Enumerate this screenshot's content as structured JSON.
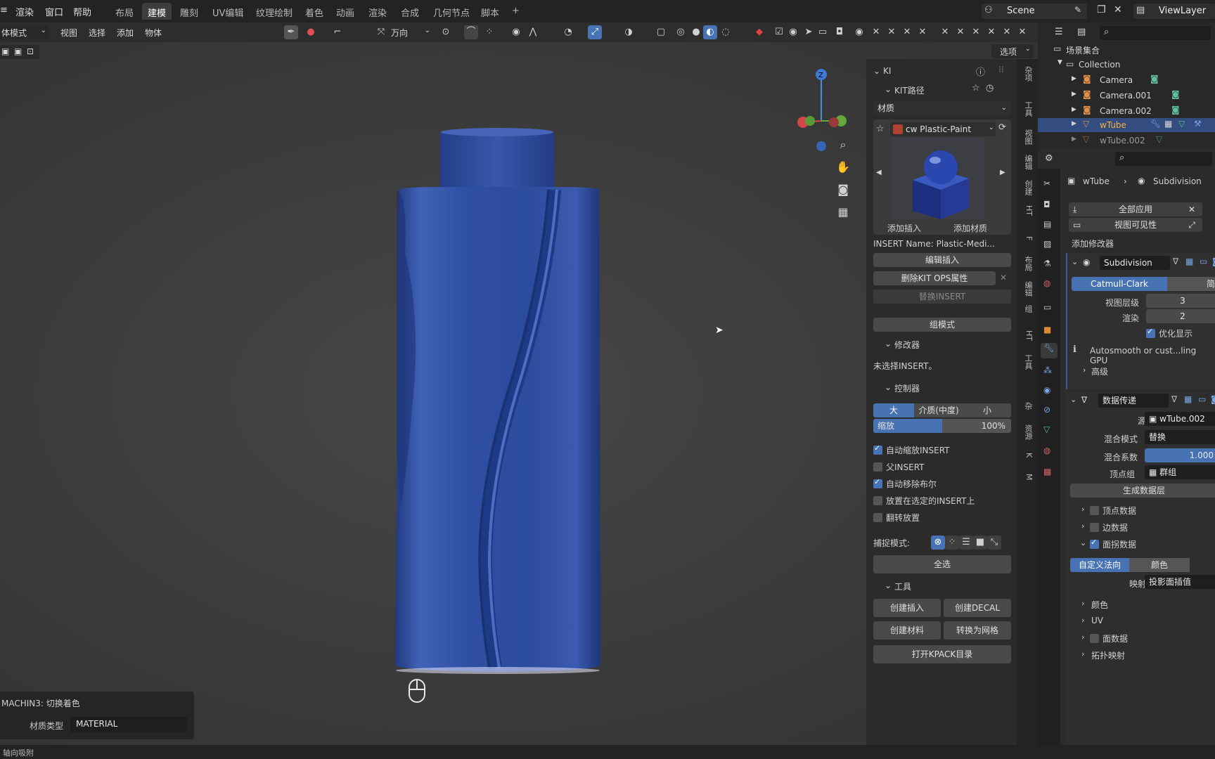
{
  "topbar": {
    "menus": [
      "渲染",
      "窗口",
      "帮助"
    ],
    "workspaces": [
      "布局",
      "建模",
      "雕刻",
      "UV编辑",
      "纹理绘制",
      "着色",
      "动画",
      "渲染",
      "合成",
      "几何节点",
      "脚本"
    ],
    "active_workspace": "建模",
    "add_tab": "+",
    "scene": "Scene",
    "viewlayer": "ViewLayer"
  },
  "header": {
    "mode": "体模式",
    "menus": [
      "视图",
      "选择",
      "添加",
      "物体"
    ],
    "orientation": "万向",
    "options": "选项"
  },
  "viewport": {
    "gizmo_axis": "Z",
    "object_color": "#2f4fa3"
  },
  "machin3_panel": {
    "title": "MACHIN3: 切换着色",
    "field_label": "材质类型",
    "field_value": "MATERIAL"
  },
  "npanel": {
    "section_kit": "KI",
    "section_kit_path": "KIT路径",
    "dropdown": "材质",
    "material_name": "cw Plastic-Paint",
    "btn_add_insert": "添加插入",
    "btn_add_material": "添加材质",
    "insert_name": "INSERT Name: Plastic-Medi...",
    "btn_edit_insert": "编辑插入",
    "btn_delete_kitops": "删除KIT OPS属性",
    "btn_replace_insert": "替换INSERT",
    "btn_group_mode": "组模式",
    "section_modifier": "修改器",
    "no_insert_selected": "未选择INSERT。",
    "section_controls": "控制器",
    "size_large": "大",
    "size_medium": "介质(中度)",
    "size_small": "小",
    "scale_label": "缩放",
    "scale_value": "100%",
    "chk_auto_scale": "自动缩放INSERT",
    "chk_parent": "父INSERT",
    "chk_auto_remove": "自动移除布尔",
    "chk_place_on_insert": "放置在选定的INSERT上",
    "chk_flip": "翻转放置",
    "snap_mode_label": "捕捉模式:",
    "btn_select_all": "全选",
    "section_tools": "工具",
    "btn_create_insert": "创建插入",
    "btn_create_decal": "创建DECAL",
    "btn_create_material": "创建材料",
    "btn_convert_mesh": "转换为网格",
    "btn_open_kpack": "打开KPACK目录"
  },
  "npanel_tabs": [
    "杂项",
    "工具",
    "视图",
    "编辑",
    "创建",
    "HT",
    "F",
    "布局",
    "编辑",
    "组",
    "HT",
    "工具",
    "杂",
    "资源",
    "K",
    "M"
  ],
  "outliner": {
    "scene_collection": "场景集合",
    "collection": "Collection",
    "items": [
      "Camera",
      "Camera.001",
      "Camera.002",
      "wTube",
      "wTube.002"
    ]
  },
  "properties": {
    "breadcrumb_object": "wTube",
    "breadcrumb_modifier": "Subdivision",
    "btn_apply_all": "全部应用",
    "btn_viewport_vis": "视图可见性",
    "add_modifier": "添加修改器",
    "mod1_name": "Subdivision",
    "catmull": "Catmull-Clark",
    "simple": "简",
    "viewport_levels_label": "视图层级",
    "viewport_levels": "3",
    "render_label": "渲染",
    "render_levels": "2",
    "optimal_display": "优化显示",
    "autosmooth_note": "Autosmooth or cust...ling GPU",
    "advanced": "高级",
    "mod2_name": "数据传递",
    "source_label": "源",
    "source_value": "wTube.002",
    "mix_mode_label": "混合模式",
    "mix_mode_value": "替换",
    "mix_factor_label": "混合系数",
    "mix_factor_value": "1.000",
    "vgroup_label": "顶点组",
    "vgroup_value": "群组",
    "btn_generate_layers": "生成数据层",
    "vertex_data": "顶点数据",
    "edge_data": "边数据",
    "face_corner_data": "面拐数据",
    "tab_custom_normal": "自定义法向",
    "tab_color": "颜色",
    "mapping_label": "映射",
    "mapping_value": "投影面插值",
    "color": "颜色",
    "uv": "UV",
    "face_data": "面数据",
    "topology_mapping": "拓扑映射"
  },
  "statusbar": {
    "text": "轴向吸附"
  }
}
